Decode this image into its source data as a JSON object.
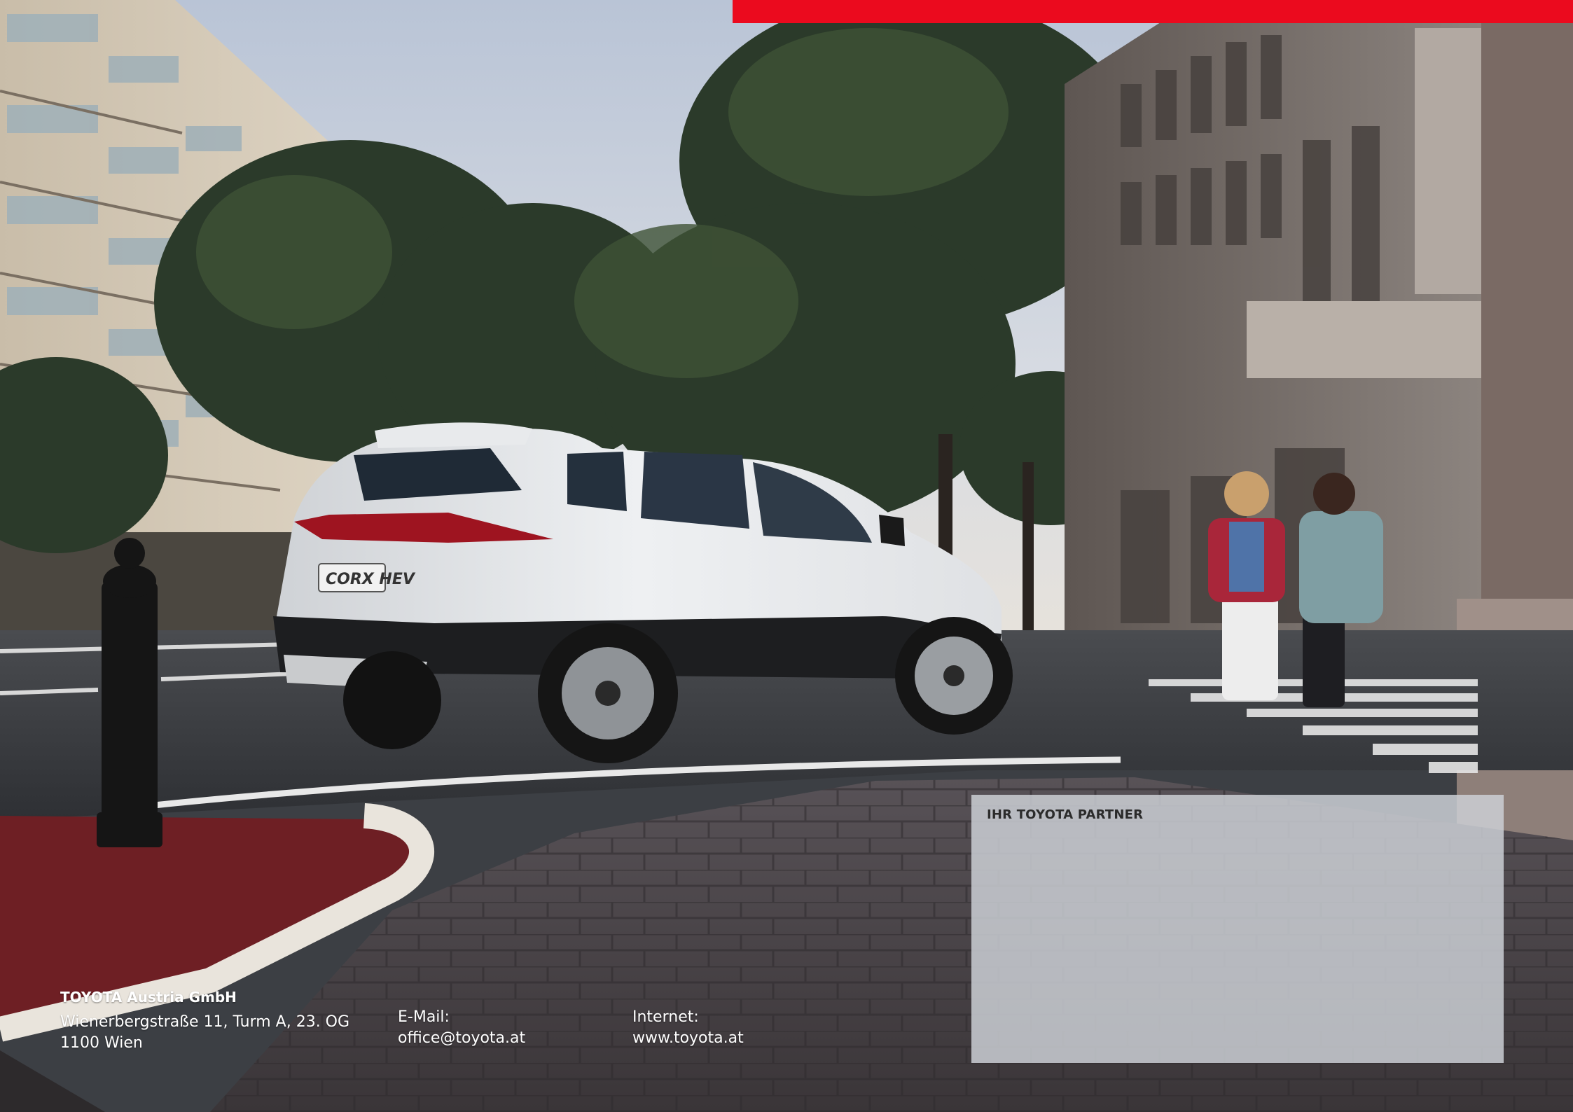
{
  "colors": {
    "brand_red": "#eb0a1e",
    "sky": "#c9d2e0",
    "partner_box": "#cdd0d6"
  },
  "photo": {
    "license_plate": "CORX HEV"
  },
  "partner": {
    "label": "IHR TOYOTA PARTNER"
  },
  "footer": {
    "company_name": "TOYOTA Austria GmbH",
    "address_line1": "Wienerbergstraße 11, Turm A, 23. OG",
    "address_line2": "1100 Wien",
    "email_label": "E-Mail:",
    "email_value": "office@toyota.at",
    "internet_label": "Internet:",
    "internet_value": "www.toyota.at"
  }
}
